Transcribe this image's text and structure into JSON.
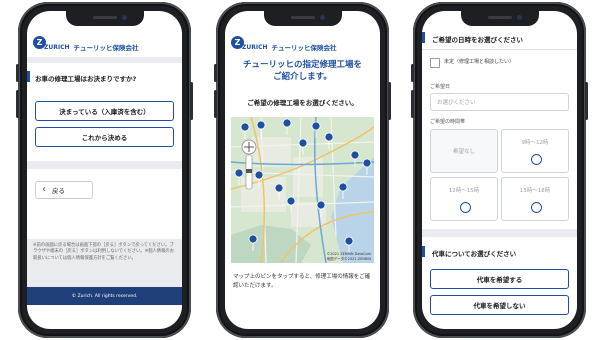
{
  "brand": {
    "mark": "Z",
    "logo_text": "ZURICH",
    "name": "チューリッヒ保険会社"
  },
  "left": {
    "question": "お車の修理工場はお決まりですか?",
    "decided_label": "決まっている（入庫済を含む）",
    "later_label": "これから決める",
    "back_label": "戻る",
    "back_arrow": "‹",
    "footnote": "※前の画面に戻る場合は画面下部の［戻る］ボタンで戻ってください。ブラウザや端末の［戻る］ボタンは利用しないでください。※個人情報のお取扱いについては個人情報保護方針をご覧ください。",
    "copyright": "© Zurich. All rights reserved."
  },
  "middle": {
    "headline_1": "チューリッヒの指定修理工場を",
    "headline_2": "ご紹介します。",
    "subhead": "ご希望の修理工場をお選びください。",
    "map_credit": "©2021 ZENRIN DataCom\n地図データ©2021 ZENRIN",
    "instruction": "マップ上のピンをタップすると、修理工場の情報をご確認いただけます。"
  },
  "right": {
    "section_title": "ご希望の日時をお選びください",
    "undecided_label": "未定（修理工場と相談したい）",
    "date_label": "ご希望日",
    "date_placeholder": "お選びください",
    "time_label": "ご希望の時間帯",
    "slots": [
      "希望なし",
      "9時〜12時",
      "12時〜15時",
      "15時〜18時"
    ],
    "rental_title": "代車についてお選びください",
    "rental_yes": "代車を希望する",
    "rental_no": "代車を希望しない"
  }
}
